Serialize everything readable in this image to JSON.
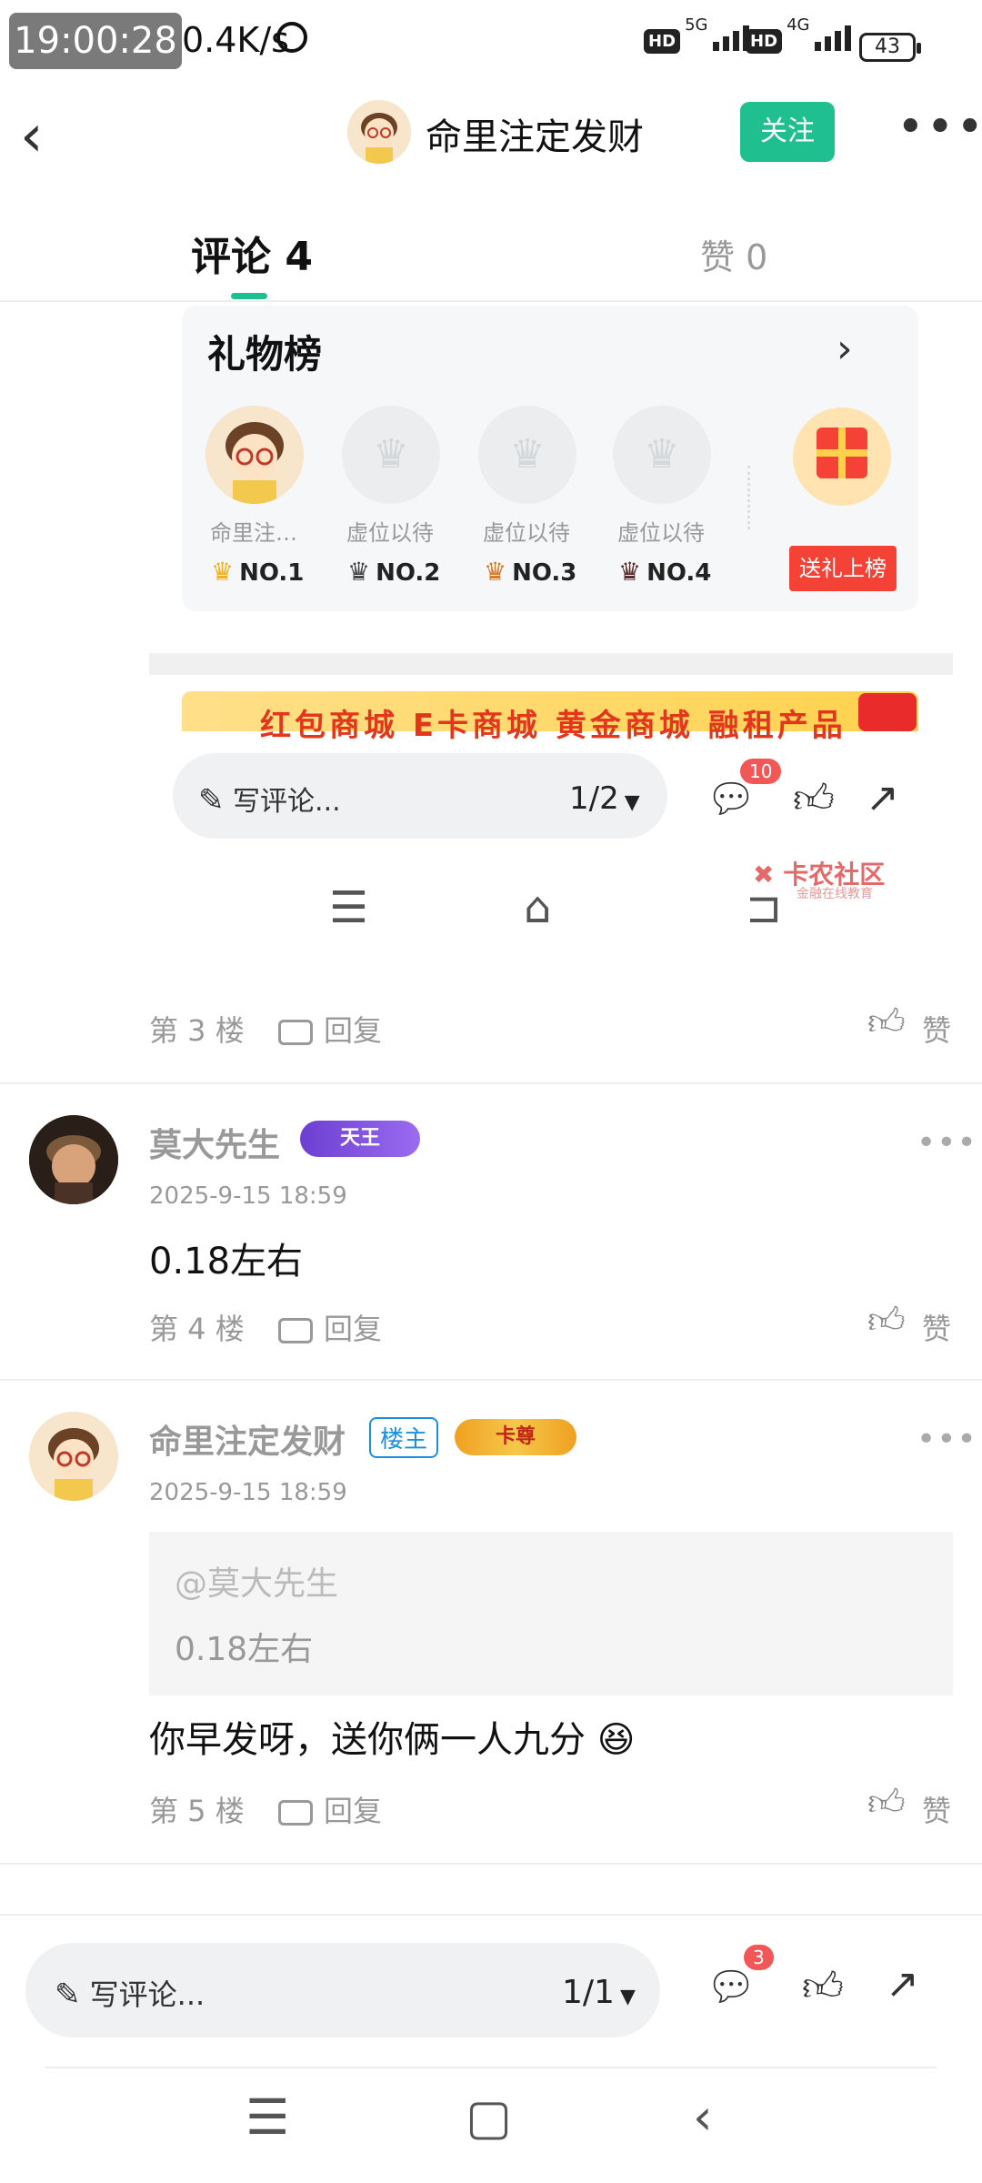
{
  "status_bar": {
    "time": "19:00:28",
    "net_speed": "0.4K/s",
    "sim1_hd": "HD",
    "sim1_gen": "5G",
    "sim2_hd": "HD",
    "sim2_gen": "4G",
    "battery": "43"
  },
  "header": {
    "title": "命里注定发财",
    "follow_label": "关注"
  },
  "tabs": [
    {
      "label": "评论 4",
      "active": true
    },
    {
      "label": "赞 0",
      "active": false
    }
  ],
  "gift_board": {
    "title": "礼物榜",
    "slots": [
      {
        "label": "命里注…",
        "rank": "NO.1"
      },
      {
        "label": "虚位以待",
        "rank": "NO.2"
      },
      {
        "label": "虚位以待",
        "rank": "NO.3"
      },
      {
        "label": "虚位以待",
        "rank": "NO.4"
      }
    ],
    "send_label": "送礼上榜"
  },
  "banner_text": "红包商城 E卡商城 黄金商城 融租产品",
  "embedded_bar": {
    "placeholder": "写评论...",
    "page": "1/2",
    "comment_badge": "10",
    "watermark": "卡农社区",
    "watermark_sub": "金融在线教育"
  },
  "comments": [
    {
      "floor": "第 3 楼",
      "reply": "回复",
      "like": "赞"
    },
    {
      "user": "莫大先生",
      "badge": "天王",
      "time": "2025-9-15 18:59",
      "text": "0.18左右",
      "floor": "第 4 楼",
      "reply": "回复",
      "like": "赞"
    },
    {
      "user": "命里注定发财",
      "owner_tag": "楼主",
      "badge": "卡尊",
      "time": "2025-9-15 18:59",
      "quote_user": "@莫大先生",
      "quote_text": "0.18左右",
      "text": "你早发呀，送你俩一人九分",
      "emoji": "😆",
      "floor": "第 5 楼",
      "reply": "回复",
      "like": "赞"
    }
  ],
  "bottom_bar": {
    "placeholder": "写评论...",
    "page": "1/1",
    "comment_badge": "3"
  },
  "colors": {
    "accent": "#1fbf8f",
    "gift_red": "#f44236",
    "owner_blue": "#1a8fe0"
  }
}
